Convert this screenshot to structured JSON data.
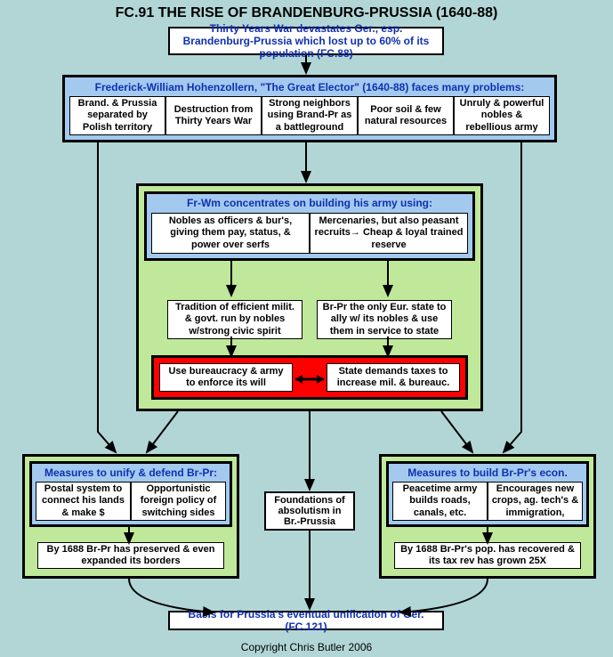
{
  "title": "FC.91 THE RISE OF BRANDENBURG-PRUSSIA (1640-88)",
  "top_box": "Thirty Years War devastates Ger., esp. Brandenburg-Prussia which lost up to 60% of its population (FC.88)",
  "problems": {
    "header": "Frederick-William Hohenzollern, \"The Great Elector\" (1640-88) faces many problems:",
    "cells": [
      "Brand. & Prussia separated by Polish territory",
      "Destruction from Thirty Years War",
      "Strong neighbors using Brand-Pr as a battleground",
      "Poor soil & few natural resources",
      "Unruly & powerful nobles & rebellious army"
    ]
  },
  "army": {
    "header": "Fr-Wm concentrates on building his army using:",
    "row1": [
      "Nobles as officers & bur's, giving them pay, status, & power over serfs",
      "Mercenaries, but also peasant recruits→ Cheap & loyal trained reserve"
    ],
    "row2": [
      "Tradition of efficient milit. & govt. run by nobles w/strong civic spirit",
      "Br-Pr the only Eur. state to ally w/ its nobles & use them in service to state"
    ],
    "red": [
      "Use bureaucracy & army to enforce its will",
      "State demands taxes to increase mil. & bureauc."
    ]
  },
  "unify": {
    "header": "Measures to unify & defend Br-Pr:",
    "cells": [
      "Postal system to connect his lands & make $",
      "Opportunistic foreign policy of switching sides"
    ],
    "result": "By 1688 Br-Pr has preserved & even expanded its borders"
  },
  "econ": {
    "header": "Measures to build Br-Pr's econ.",
    "cells": [
      "Peacetime army builds roads, canals, etc.",
      "Encourages new crops, ag. tech's & immigration,"
    ],
    "result": "By 1688 Br-Pr's pop. has recovered & its tax rev has grown 25X"
  },
  "foundations": "Foundations of absolutism in Br.-Prussia",
  "basis": "Basis for Prussia's eventual unification of Ger. (FC.121)",
  "copyright": "Copyright Chris Butler 2006"
}
